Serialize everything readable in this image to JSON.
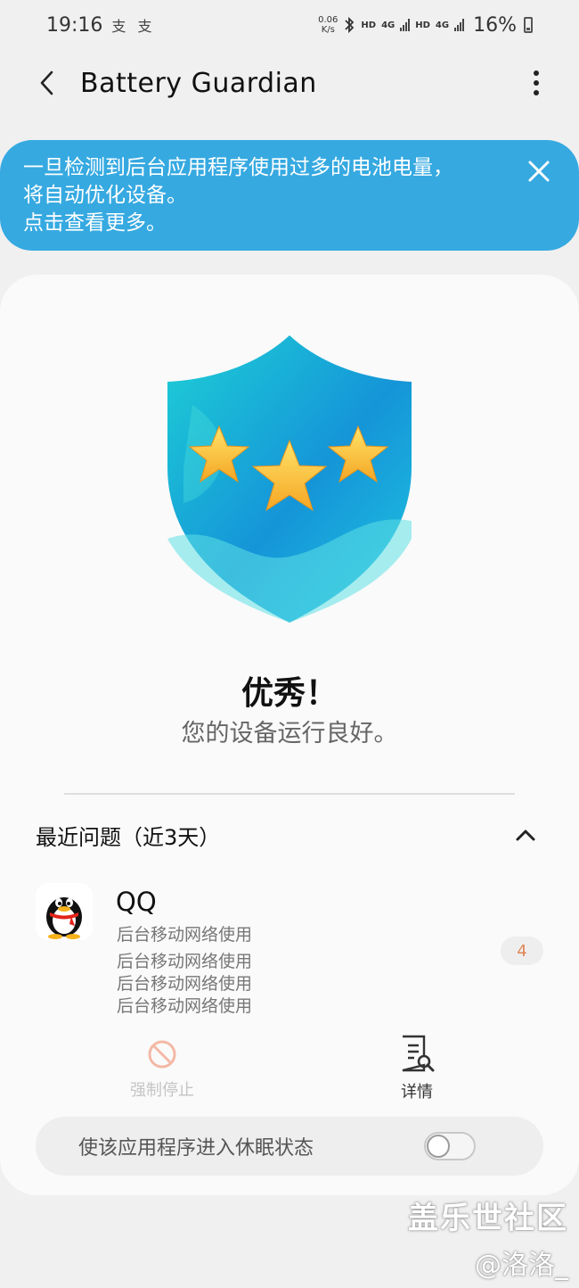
{
  "status_bar": {
    "time": "19:16",
    "notification_icons": "支 支",
    "net_speed_value": "0.06",
    "net_speed_unit": "K/s",
    "hd1": "HD",
    "lte1": "4G",
    "hd2": "HD",
    "lte2": "4G",
    "battery_percent": "16%",
    "icons": [
      "bluetooth-icon",
      "signal-icon",
      "battery-icon"
    ]
  },
  "header": {
    "title": "Battery Guardian",
    "back_icon": "back-arrow-icon",
    "more_icon": "more-options-icon"
  },
  "banner": {
    "lines": [
      "一旦检测到后台应用程序使用过多的电池电量，",
      "将自动优化设备。",
      "点击查看更多。"
    ],
    "close_icon": "close-icon",
    "color": "#36a9e1"
  },
  "status": {
    "title": "优秀！",
    "subtitle": "您的设备运行良好。",
    "shield_icon": "shield-three-stars-icon"
  },
  "recent_issues": {
    "heading": "最近问题（近3天）",
    "collapse_icon": "chevron-up-icon",
    "app": {
      "name": "QQ",
      "icon": "qq-penguin-icon",
      "usage": [
        "后台移动网络使用",
        "后台移动网络使用",
        "后台移动网络使用",
        "后台移动网络使用"
      ],
      "count": "4",
      "count_color": "#e08756"
    },
    "actions": {
      "force_stop": "强制停止",
      "force_stop_icon": "prohibited-icon",
      "details": "详情",
      "details_icon": "document-search-icon"
    },
    "sleep_toggle": {
      "label": "使该应用程序进入休眠状态",
      "on": false
    }
  },
  "watermark": {
    "line1": "盖乐世社区",
    "line2": "@洛洛_"
  }
}
